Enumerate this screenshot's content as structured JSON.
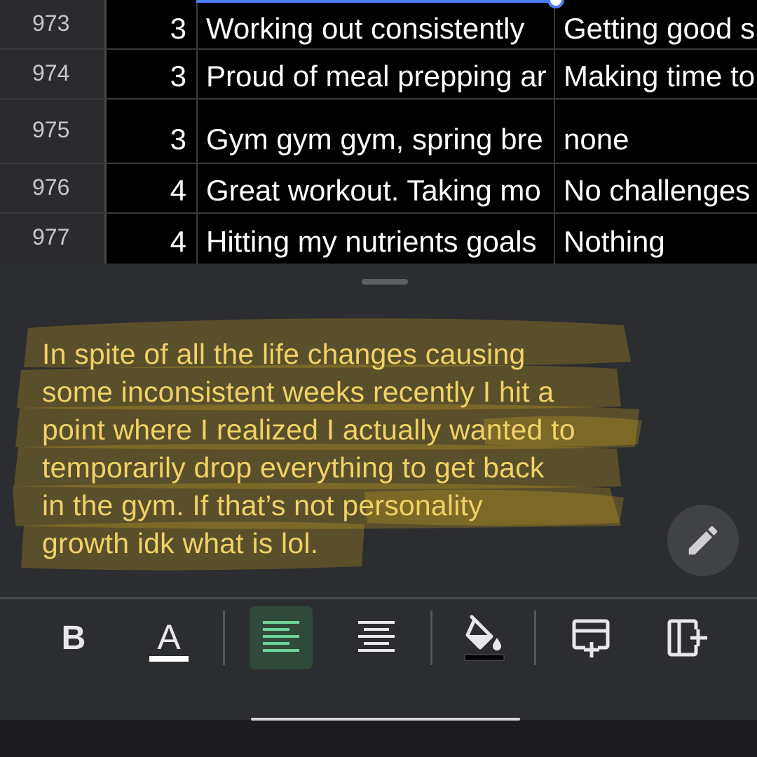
{
  "grid": {
    "rows": [
      {
        "rownum": "973",
        "value": "3",
        "col1": "Working out consistently",
        "col2": "Getting good s"
      },
      {
        "rownum": "974",
        "value": "3",
        "col1": "Proud of meal prepping ar",
        "col2": "Making time to"
      },
      {
        "rownum": "975",
        "value": "3",
        "col1": "Gym gym gym, spring bre",
        "col2": "none"
      },
      {
        "rownum": "976",
        "value": "4",
        "col1": "Great workout. Taking mo",
        "col2": "No challenges"
      },
      {
        "rownum": "977",
        "value": "4",
        "col1": "Hitting my nutrients goals",
        "col2": "Nothing"
      }
    ]
  },
  "editor": {
    "text_lines": [
      "In spite of all the life changes causing",
      "some inconsistent weeks recently I hit a",
      "point where I realized I actually wanted to",
      "temporarily drop everything to get back",
      "in the gym. If that’s not personality",
      "growth idk what is lol."
    ],
    "highlight_color": "#e0b21f",
    "text_color": "#f2d266"
  },
  "toolbar": {
    "bold_label": "B",
    "text_color_label": "A",
    "items": [
      {
        "icon": "bold-icon"
      },
      {
        "icon": "text-color-icon"
      },
      {
        "icon": "align-left-icon",
        "active": true
      },
      {
        "icon": "align-center-icon"
      },
      {
        "icon": "fill-color-icon"
      },
      {
        "icon": "insert-row-icon"
      },
      {
        "icon": "insert-column-icon"
      }
    ],
    "accent": "#6fd39a"
  }
}
